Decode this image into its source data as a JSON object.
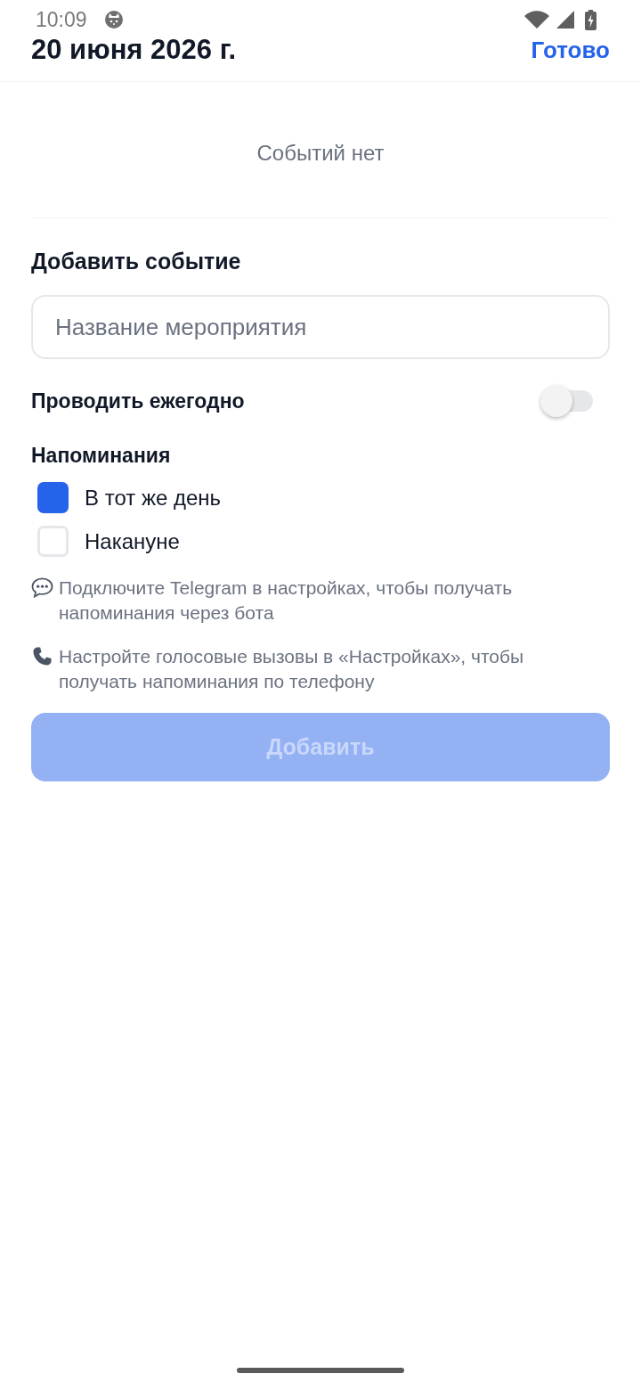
{
  "status_bar": {
    "time": "10:09"
  },
  "header": {
    "title": "20 июня 2026 г.",
    "done_button": "Готово"
  },
  "events": {
    "empty_text": "Событий нет"
  },
  "add_event": {
    "heading": "Добавить событие",
    "name_field": {
      "placeholder": "Название мероприятия"
    },
    "yearly": {
      "label": "Проводить ежегодно",
      "on": false
    },
    "reminders": {
      "heading": "Напоминания",
      "options": [
        {
          "label": "В тот же день",
          "checked": true
        },
        {
          "label": "Накануне",
          "checked": false
        }
      ]
    },
    "hints": [
      {
        "kind": "chat",
        "text": "Подключите Telegram в настройках, чтобы получать напоминания через бота"
      },
      {
        "kind": "phone",
        "text": "Настройте голосовые вызовы в «Настройках», чтобы получать напоминания по телефону"
      }
    ],
    "submit_button": {
      "label": "Добавить",
      "disabled": true
    }
  }
}
